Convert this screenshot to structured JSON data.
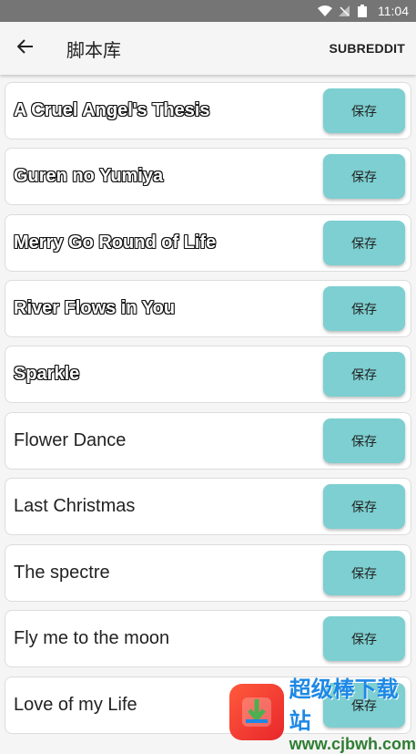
{
  "status_bar": {
    "time": "11:04"
  },
  "app_bar": {
    "title": "脚本库",
    "action": "SUBREDDIT"
  },
  "items": [
    {
      "title": "A Cruel Angel's Thesis",
      "save": "保存"
    },
    {
      "title": "Guren no Yumiya",
      "save": "保存"
    },
    {
      "title": "Merry Go Round of Life",
      "save": "保存"
    },
    {
      "title": "River Flows in You",
      "save": "保存"
    },
    {
      "title": "Sparkle",
      "save": "保存"
    },
    {
      "title": "Flower Dance",
      "save": "保存"
    },
    {
      "title": "Last Christmas",
      "save": "保存"
    },
    {
      "title": "The spectre",
      "save": "保存"
    },
    {
      "title": "Fly me to the moon",
      "save": "保存"
    },
    {
      "title": "Love of my Life",
      "save": "保存"
    }
  ],
  "watermark": {
    "text_cn": "超级棒下载站",
    "url": "www.cjbwh.com"
  },
  "colors": {
    "accent": "#7dcfd1",
    "status_bar": "#757575"
  }
}
